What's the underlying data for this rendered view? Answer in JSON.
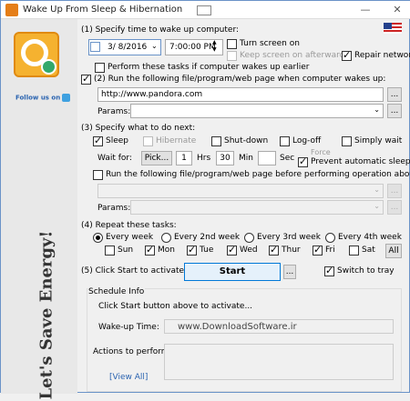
{
  "window": {
    "title": "Wake Up From Sleep & Hibernation",
    "minimize": "—",
    "close": "✕"
  },
  "sidebar": {
    "follow_text": "Follow us on",
    "slogan": "Let's Save Energy!"
  },
  "section1": {
    "label": "(1) Specify time to wake up computer:",
    "date": "3/ 8/2016",
    "time": "7:00:00 PM",
    "turn_screen_on": "Turn screen on",
    "keep_screen_on": "Keep screen on afterwards",
    "repair_network": "Repair network",
    "perform_earlier": "Perform these tasks if computer wakes up earlier"
  },
  "section2": {
    "label": "(2) Run the following file/program/web page when computer wakes up:",
    "url": "http://www.pandora.com",
    "params_label": "Params:",
    "browse": "..."
  },
  "section3": {
    "label": "(3) Specify what to do next:",
    "sleep": "Sleep",
    "hibernate": "Hibernate",
    "shutdown": "Shut-down",
    "logoff": "Log-off",
    "simply_wait": "Simply wait",
    "force": "Force",
    "wait_for": "Wait for:",
    "pick": "Pick...",
    "hrs_value": "1",
    "hrs": "Hrs",
    "min_value": "30",
    "min": "Min",
    "sec_value": "",
    "sec": "Sec",
    "prevent_sleep": "Prevent automatic sleep",
    "run_before": "Run the following file/program/web page before performing operation above:",
    "params_label": "Params:",
    "browse": "..."
  },
  "section4": {
    "label": "(4) Repeat these tasks:",
    "every_week": "Every week",
    "every_2nd": "Every 2nd week",
    "every_3rd": "Every 3rd week",
    "every_4th": "Every 4th week",
    "days": [
      "Sun",
      "Mon",
      "Tue",
      "Wed",
      "Thur",
      "Fri",
      "Sat"
    ],
    "all": "All"
  },
  "section5": {
    "label": "(5) Click Start to activate:",
    "start": "Start",
    "more": "...",
    "switch_tray": "Switch to tray"
  },
  "schedule": {
    "title": "Schedule Info",
    "hint": "Click Start button above to activate...",
    "wake_label": "Wake-up Time:",
    "wake_value": "www.DownloadSoftware.ir",
    "actions_label": "Actions to perform:",
    "view_all": "[View All]"
  }
}
